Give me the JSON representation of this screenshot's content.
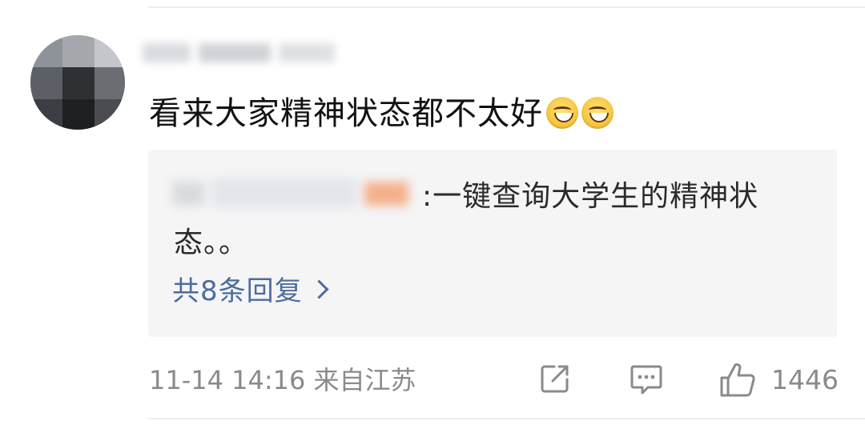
{
  "comment": {
    "text": "看来大家精神状态都不太好",
    "emojis": [
      "grin-squint-emoji",
      "grin-squint-emoji"
    ]
  },
  "reply": {
    "text": ":一键查询大学生的精神状态。。",
    "more_label": "共8条回复"
  },
  "footer": {
    "meta": "11-14 14:16 来自江苏",
    "like_count": "1446",
    "icons": [
      "share-icon",
      "comment-icon",
      "like-icon"
    ]
  },
  "colors": {
    "link": "#4c6c9c",
    "muted": "#8a8a8a",
    "reply_bg": "#f5f5f6"
  }
}
